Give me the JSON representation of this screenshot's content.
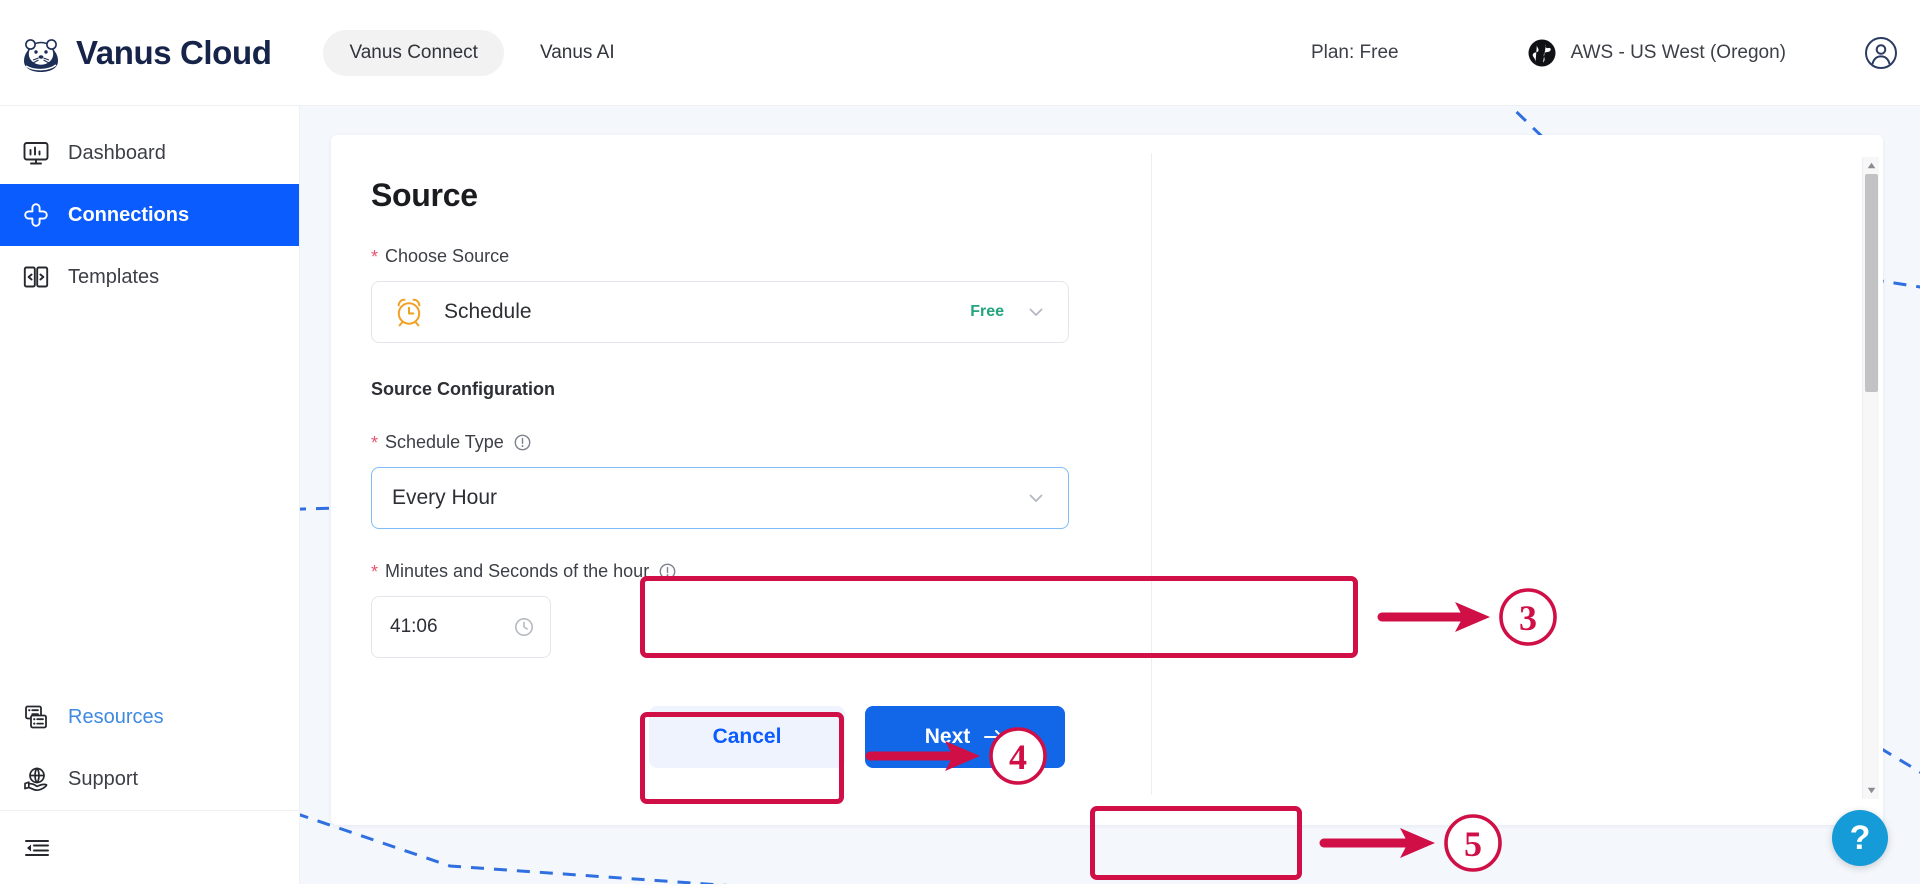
{
  "header": {
    "brand_name": "Vanus Cloud",
    "brand_logo_icon": "otter-logo-icon",
    "tabs": [
      {
        "label": "Vanus Connect",
        "active": true
      },
      {
        "label": "Vanus AI",
        "active": false
      }
    ],
    "plan_label": "Plan: Free",
    "region_icon": "globe-icon",
    "region_label": "AWS - US West (Oregon)",
    "account_icon": "user-circle-icon"
  },
  "sidebar": {
    "top_items": [
      {
        "label": "Dashboard",
        "icon": "monitor-chart-icon",
        "active": false
      },
      {
        "label": "Connections",
        "icon": "connections-icon",
        "active": true
      },
      {
        "label": "Templates",
        "icon": "templates-icon",
        "active": false
      }
    ],
    "bottom_items": [
      {
        "label": "Resources",
        "icon": "resources-icon",
        "link": true
      },
      {
        "label": "Support",
        "icon": "support-globe-hand-icon",
        "link": false
      }
    ],
    "collapse_icon": "collapse-sidebar-icon"
  },
  "main": {
    "title": "Source",
    "choose_source": {
      "label": "Choose Source",
      "required_marker": "*",
      "selected_icon": "alarm-clock-icon",
      "selected_name": "Schedule",
      "badge": "Free",
      "chevron_icon": "chevron-down-icon"
    },
    "source_configuration_label": "Source Configuration",
    "schedule_type": {
      "label": "Schedule Type",
      "required_marker": "*",
      "info_icon": "info-circle-icon",
      "value": "Every Hour",
      "chevron_icon": "chevron-down-icon"
    },
    "minutes_seconds": {
      "label": "Minutes and Seconds of the hour",
      "required_marker": "*",
      "info_icon": "info-circle-icon",
      "value": "41:06",
      "clock_icon": "clock-icon"
    },
    "buttons": {
      "cancel_label": "Cancel",
      "next_label": "Next",
      "next_arrow_icon": "arrow-right-icon"
    }
  },
  "annotations": [
    {
      "number": "3",
      "target": "schedule-type-select"
    },
    {
      "number": "4",
      "target": "minutes-seconds-input"
    },
    {
      "number": "5",
      "target": "next-button"
    }
  ],
  "scrollbar": {
    "up_arrow_icon": "scroll-up-arrow-icon",
    "down_arrow_icon": "scroll-down-arrow-icon"
  },
  "help_button": {
    "label": "?",
    "icon": "help-question-icon"
  },
  "colors": {
    "accent_blue": "#0b5cff",
    "button_blue": "#1267e8",
    "annotation_crimson": "#cf0f45",
    "badge_green": "#24a47e",
    "required_red": "#e8526e",
    "brand_navy": "#16244a",
    "help_cyan": "#159bd7",
    "page_bg": "#f4f7fc"
  }
}
